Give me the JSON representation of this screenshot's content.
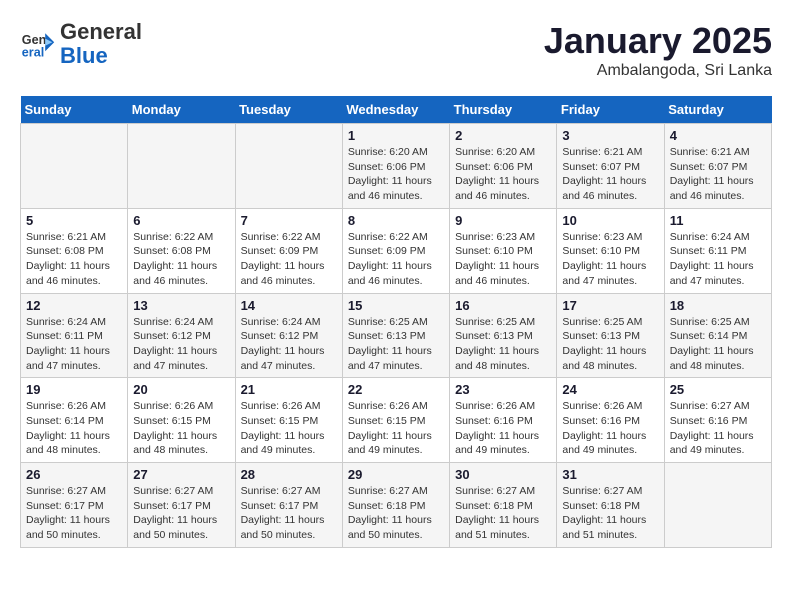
{
  "header": {
    "logo_general": "General",
    "logo_blue": "Blue",
    "month": "January 2025",
    "location": "Ambalangoda, Sri Lanka"
  },
  "weekdays": [
    "Sunday",
    "Monday",
    "Tuesday",
    "Wednesday",
    "Thursday",
    "Friday",
    "Saturday"
  ],
  "weeks": [
    [
      {
        "day": "",
        "info": ""
      },
      {
        "day": "",
        "info": ""
      },
      {
        "day": "",
        "info": ""
      },
      {
        "day": "1",
        "info": "Sunrise: 6:20 AM\nSunset: 6:06 PM\nDaylight: 11 hours\nand 46 minutes."
      },
      {
        "day": "2",
        "info": "Sunrise: 6:20 AM\nSunset: 6:06 PM\nDaylight: 11 hours\nand 46 minutes."
      },
      {
        "day": "3",
        "info": "Sunrise: 6:21 AM\nSunset: 6:07 PM\nDaylight: 11 hours\nand 46 minutes."
      },
      {
        "day": "4",
        "info": "Sunrise: 6:21 AM\nSunset: 6:07 PM\nDaylight: 11 hours\nand 46 minutes."
      }
    ],
    [
      {
        "day": "5",
        "info": "Sunrise: 6:21 AM\nSunset: 6:08 PM\nDaylight: 11 hours\nand 46 minutes."
      },
      {
        "day": "6",
        "info": "Sunrise: 6:22 AM\nSunset: 6:08 PM\nDaylight: 11 hours\nand 46 minutes."
      },
      {
        "day": "7",
        "info": "Sunrise: 6:22 AM\nSunset: 6:09 PM\nDaylight: 11 hours\nand 46 minutes."
      },
      {
        "day": "8",
        "info": "Sunrise: 6:22 AM\nSunset: 6:09 PM\nDaylight: 11 hours\nand 46 minutes."
      },
      {
        "day": "9",
        "info": "Sunrise: 6:23 AM\nSunset: 6:10 PM\nDaylight: 11 hours\nand 46 minutes."
      },
      {
        "day": "10",
        "info": "Sunrise: 6:23 AM\nSunset: 6:10 PM\nDaylight: 11 hours\nand 47 minutes."
      },
      {
        "day": "11",
        "info": "Sunrise: 6:24 AM\nSunset: 6:11 PM\nDaylight: 11 hours\nand 47 minutes."
      }
    ],
    [
      {
        "day": "12",
        "info": "Sunrise: 6:24 AM\nSunset: 6:11 PM\nDaylight: 11 hours\nand 47 minutes."
      },
      {
        "day": "13",
        "info": "Sunrise: 6:24 AM\nSunset: 6:12 PM\nDaylight: 11 hours\nand 47 minutes."
      },
      {
        "day": "14",
        "info": "Sunrise: 6:24 AM\nSunset: 6:12 PM\nDaylight: 11 hours\nand 47 minutes."
      },
      {
        "day": "15",
        "info": "Sunrise: 6:25 AM\nSunset: 6:13 PM\nDaylight: 11 hours\nand 47 minutes."
      },
      {
        "day": "16",
        "info": "Sunrise: 6:25 AM\nSunset: 6:13 PM\nDaylight: 11 hours\nand 48 minutes."
      },
      {
        "day": "17",
        "info": "Sunrise: 6:25 AM\nSunset: 6:13 PM\nDaylight: 11 hours\nand 48 minutes."
      },
      {
        "day": "18",
        "info": "Sunrise: 6:25 AM\nSunset: 6:14 PM\nDaylight: 11 hours\nand 48 minutes."
      }
    ],
    [
      {
        "day": "19",
        "info": "Sunrise: 6:26 AM\nSunset: 6:14 PM\nDaylight: 11 hours\nand 48 minutes."
      },
      {
        "day": "20",
        "info": "Sunrise: 6:26 AM\nSunset: 6:15 PM\nDaylight: 11 hours\nand 48 minutes."
      },
      {
        "day": "21",
        "info": "Sunrise: 6:26 AM\nSunset: 6:15 PM\nDaylight: 11 hours\nand 49 minutes."
      },
      {
        "day": "22",
        "info": "Sunrise: 6:26 AM\nSunset: 6:15 PM\nDaylight: 11 hours\nand 49 minutes."
      },
      {
        "day": "23",
        "info": "Sunrise: 6:26 AM\nSunset: 6:16 PM\nDaylight: 11 hours\nand 49 minutes."
      },
      {
        "day": "24",
        "info": "Sunrise: 6:26 AM\nSunset: 6:16 PM\nDaylight: 11 hours\nand 49 minutes."
      },
      {
        "day": "25",
        "info": "Sunrise: 6:27 AM\nSunset: 6:16 PM\nDaylight: 11 hours\nand 49 minutes."
      }
    ],
    [
      {
        "day": "26",
        "info": "Sunrise: 6:27 AM\nSunset: 6:17 PM\nDaylight: 11 hours\nand 50 minutes."
      },
      {
        "day": "27",
        "info": "Sunrise: 6:27 AM\nSunset: 6:17 PM\nDaylight: 11 hours\nand 50 minutes."
      },
      {
        "day": "28",
        "info": "Sunrise: 6:27 AM\nSunset: 6:17 PM\nDaylight: 11 hours\nand 50 minutes."
      },
      {
        "day": "29",
        "info": "Sunrise: 6:27 AM\nSunset: 6:18 PM\nDaylight: 11 hours\nand 50 minutes."
      },
      {
        "day": "30",
        "info": "Sunrise: 6:27 AM\nSunset: 6:18 PM\nDaylight: 11 hours\nand 51 minutes."
      },
      {
        "day": "31",
        "info": "Sunrise: 6:27 AM\nSunset: 6:18 PM\nDaylight: 11 hours\nand 51 minutes."
      },
      {
        "day": "",
        "info": ""
      }
    ]
  ]
}
